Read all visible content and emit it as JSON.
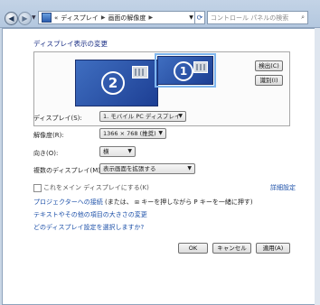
{
  "nav": {
    "back_glyph": "◀",
    "forward_glyph": "▶",
    "breadcrumb_root": "«",
    "breadcrumb_1": "ディスプレイ",
    "breadcrumb_2": "画面の解像度",
    "refresh_icon": "refresh-icon"
  },
  "search": {
    "placeholder": "コントロール パネルの検索"
  },
  "page": {
    "heading": "ディスプレイ表示の変更"
  },
  "monitors": [
    {
      "number": "2"
    },
    {
      "number": "1"
    }
  ],
  "buttons": {
    "detect": "検出(C)",
    "identify": "識別(I)"
  },
  "fields": {
    "display_label": "ディスプレイ(S):",
    "display_value": "1. モバイル PC ディスプレイ",
    "resolution_label": "解像度(R):",
    "resolution_value": "1366 × 768 (推奨)",
    "orientation_label": "向き(O):",
    "orientation_value": "横",
    "multi_label": "複数のディスプレイ(M):",
    "multi_value": "表示画面を拡張する"
  },
  "checkbox": {
    "main_display": "これをメイン ディスプレイにする(K)"
  },
  "links": {
    "advanced": "詳細設定",
    "projector_prefix": "プロジェクターへの接続",
    "projector_suffix": "(または、",
    "projector_suffix2": "キーを押しながら P キーを一緒に押す)",
    "text_size": "テキストやその他の項目の大きさの変更",
    "which_settings": "どのディスプレイ設定を選択しますか?"
  },
  "footer": {
    "ok": "OK",
    "cancel": "キャンセル",
    "apply": "適用(A)"
  },
  "colors": {
    "link": "#1b4fa8",
    "heading": "#1e3287",
    "monitor": "#2a52a8"
  }
}
